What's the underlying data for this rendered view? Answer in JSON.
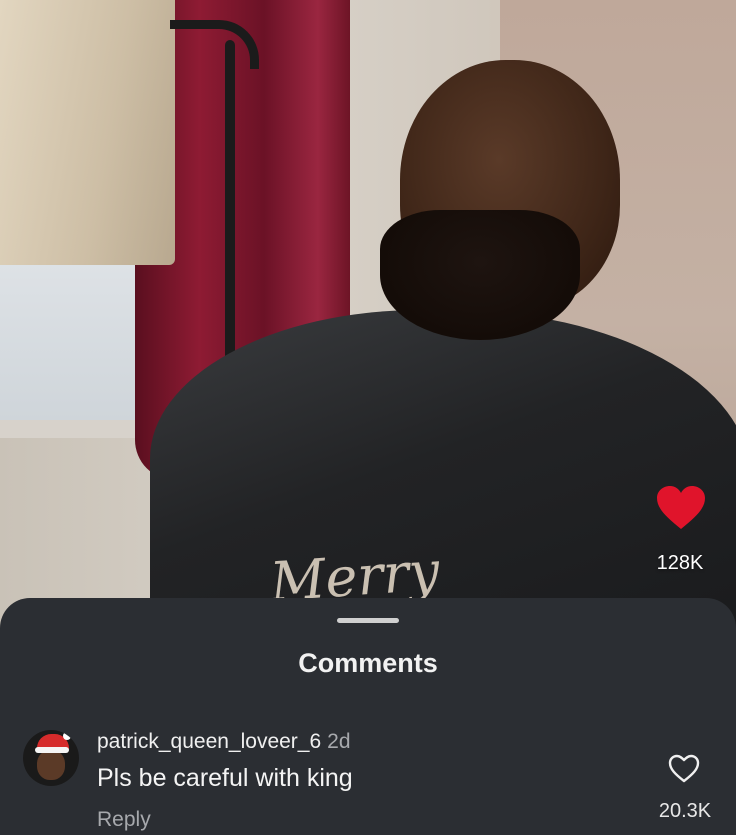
{
  "post": {
    "like_count": "128K",
    "heart_icon": "heart-filled-icon",
    "heart_color": "#e0142b",
    "cape_lettering": "Merry"
  },
  "comments_sheet": {
    "title": "Comments",
    "background": "#2b2e33",
    "items": [
      {
        "username": "patrick_queen_loveer_6",
        "time": "2d",
        "text": "Pls be careful with king",
        "reply_label": "Reply",
        "like_count": "20.3K",
        "like_icon": "heart-outline-icon"
      }
    ]
  }
}
